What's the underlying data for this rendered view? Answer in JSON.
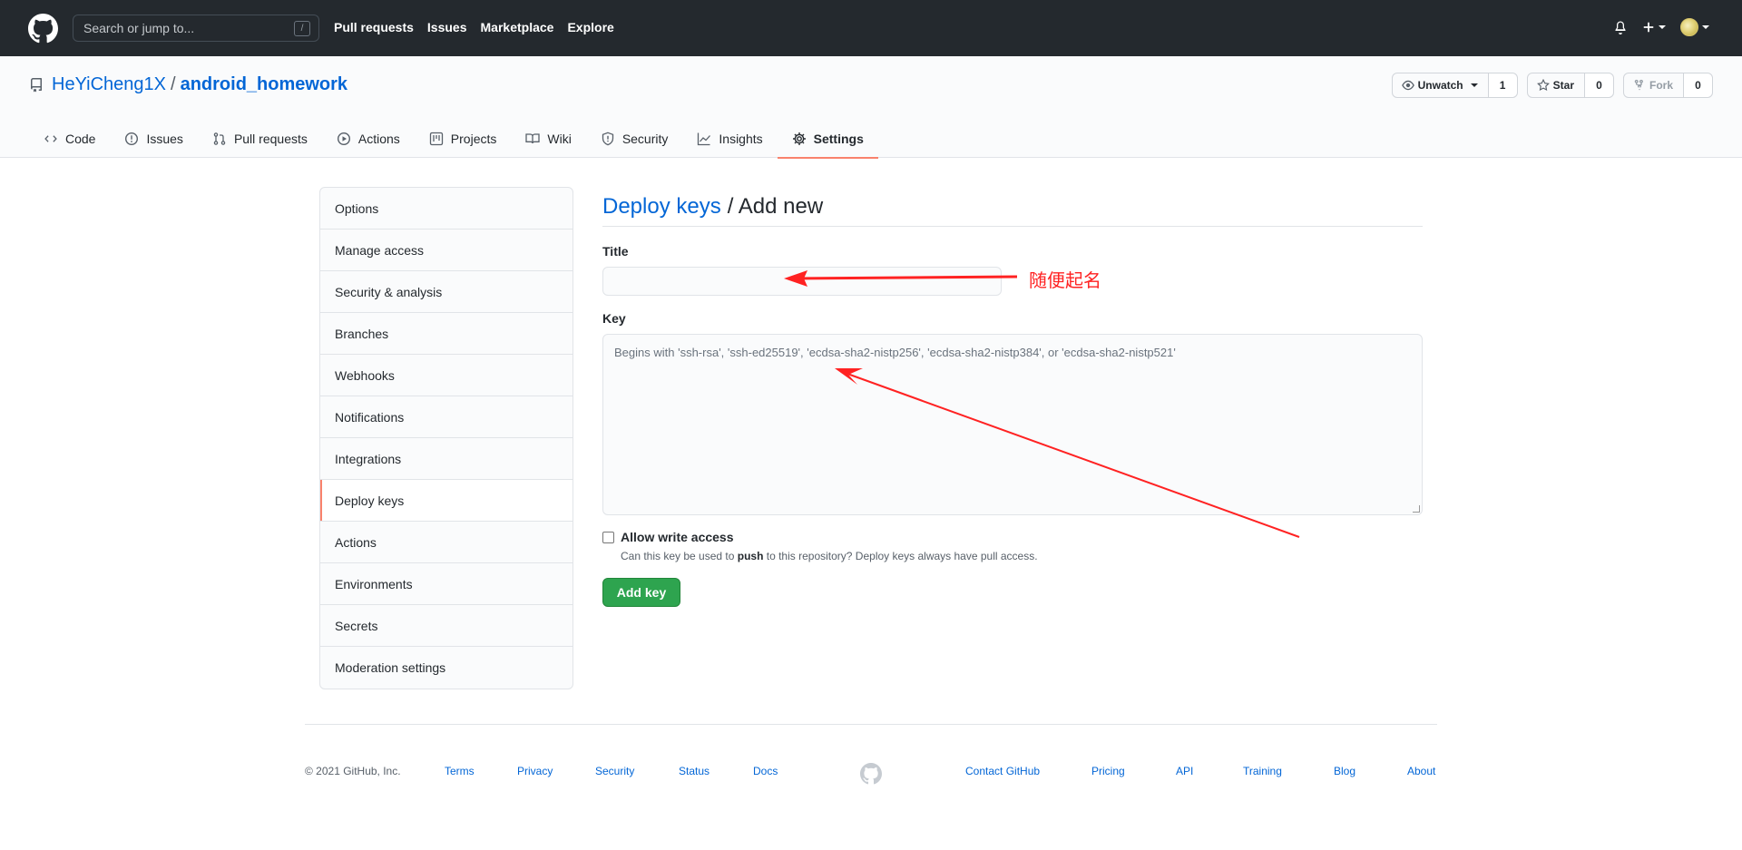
{
  "header": {
    "search_placeholder": "Search or jump to...",
    "search_shortcut": "/",
    "nav": [
      "Pull requests",
      "Issues",
      "Marketplace",
      "Explore"
    ]
  },
  "repo": {
    "owner": "HeYiCheng1X",
    "separator": "/",
    "name": "android_homework",
    "watch_label": "Unwatch",
    "watch_count": "1",
    "star_label": "Star",
    "star_count": "0",
    "fork_label": "Fork",
    "fork_count": "0"
  },
  "tabs": [
    {
      "label": "Code",
      "icon": "code-icon"
    },
    {
      "label": "Issues",
      "icon": "issue-icon"
    },
    {
      "label": "Pull requests",
      "icon": "pull-request-icon"
    },
    {
      "label": "Actions",
      "icon": "play-icon"
    },
    {
      "label": "Projects",
      "icon": "project-icon"
    },
    {
      "label": "Wiki",
      "icon": "book-icon"
    },
    {
      "label": "Security",
      "icon": "shield-icon"
    },
    {
      "label": "Insights",
      "icon": "graph-icon"
    },
    {
      "label": "Settings",
      "icon": "gear-icon"
    }
  ],
  "active_tab": "Settings",
  "sidebar": {
    "items": [
      "Options",
      "Manage access",
      "Security & analysis",
      "Branches",
      "Webhooks",
      "Notifications",
      "Integrations",
      "Deploy keys",
      "Actions",
      "Environments",
      "Secrets",
      "Moderation settings"
    ],
    "active": "Deploy keys"
  },
  "form": {
    "breadcrumb_link": "Deploy keys",
    "breadcrumb_rest": "/ Add new",
    "title_label": "Title",
    "title_value": "",
    "key_label": "Key",
    "key_placeholder": "Begins with 'ssh-rsa', 'ssh-ed25519', 'ecdsa-sha2-nistp256', 'ecdsa-sha2-nistp384', or 'ecdsa-sha2-nistp521'",
    "allow_write_label": "Allow write access",
    "allow_write_checked": false,
    "allow_write_note_pre": "Can this key be used to ",
    "allow_write_note_bold": "push",
    "allow_write_note_post": " to this repository? Deploy keys always have pull access.",
    "submit_label": "Add key"
  },
  "annotation": {
    "text": "随便起名",
    "color": "#ff2222"
  },
  "footer": {
    "copyright": "© 2021 GitHub, Inc.",
    "left_links": [
      "Terms",
      "Privacy",
      "Security",
      "Status",
      "Docs"
    ],
    "right_links": [
      "Contact GitHub",
      "Pricing",
      "API",
      "Training",
      "Blog",
      "About"
    ]
  },
  "colors": {
    "header_bg": "#24292e",
    "link": "#0366d6",
    "active_tab_underline": "#f9826c",
    "primary_button": "#2ea44f"
  }
}
